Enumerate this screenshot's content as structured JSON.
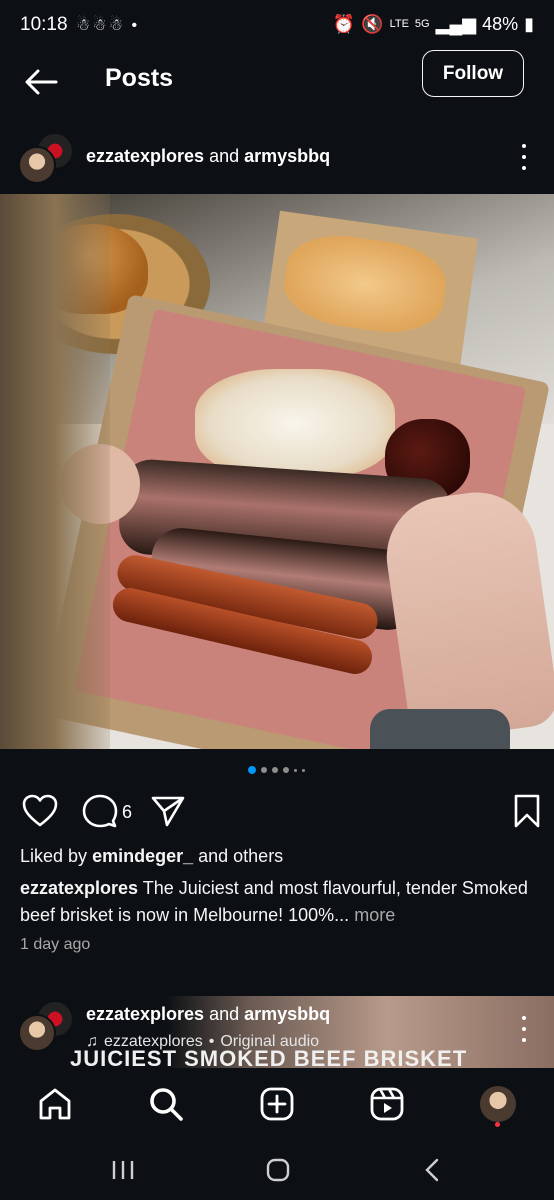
{
  "status_bar": {
    "time": "10:18",
    "notifications": "☃☃☃ •",
    "network": "LTE",
    "net_type": "5G",
    "battery": "48%"
  },
  "header": {
    "back_icon": "arrow-left-icon",
    "title": "Posts",
    "follow_label": "Follow"
  },
  "post": {
    "user_primary": "ezzatexplores",
    "user_join": "and",
    "user_secondary": "armysbbq",
    "image_alt": "Smoked beef brisket box",
    "carousel": {
      "count": 6,
      "active_index": 0
    },
    "comment_count": "6",
    "liked_prefix": "Liked by",
    "liked_user": "emindeger_",
    "liked_suffix": "and others",
    "caption_user": "ezzatexplores",
    "caption_text": "The Juiciest and most flavourful, tender Smoked beef brisket is now in Melbourne! 100%...",
    "caption_more": "more",
    "time_ago": "1 day ago"
  },
  "next_post": {
    "user_primary": "ezzatexplores",
    "user_join": "and",
    "user_secondary": "armysbbq",
    "audio_user": "ezzatexplores",
    "audio_sep": "•",
    "audio_label": "Original audio",
    "banner_text": "JUICIEST SMOKED BEEF BRISKET"
  },
  "bottom_nav": {
    "items": [
      "home-icon",
      "search-icon",
      "create-icon",
      "reels-icon",
      "profile-avatar"
    ]
  },
  "colors": {
    "background": "#0c1014",
    "accent": "#0095f6",
    "muted": "#a8a8a8",
    "notification": "#ff3040"
  }
}
